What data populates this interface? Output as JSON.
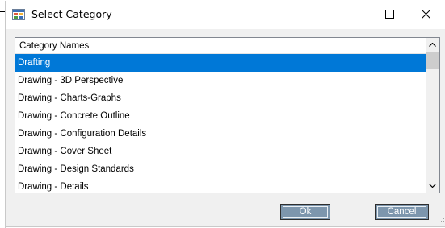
{
  "window": {
    "title": "Select Category",
    "app_icon": "window-app-icon",
    "controls": [
      "minimize-icon",
      "maximize-icon",
      "close-icon"
    ]
  },
  "list": {
    "header": "Category Names",
    "selected_index": 0,
    "items": [
      "Drafting",
      "Drawing - 3D Perspective",
      "Drawing - Charts-Graphs",
      "Drawing - Concrete Outline",
      "Drawing - Configuration Details",
      "Drawing - Cover Sheet",
      "Drawing - Design Standards",
      "Drawing - Details"
    ]
  },
  "buttons": {
    "ok": "Ok",
    "cancel": "Cancel"
  },
  "colors": {
    "selection": "#0078d7",
    "button_face": "#7d96ad"
  }
}
